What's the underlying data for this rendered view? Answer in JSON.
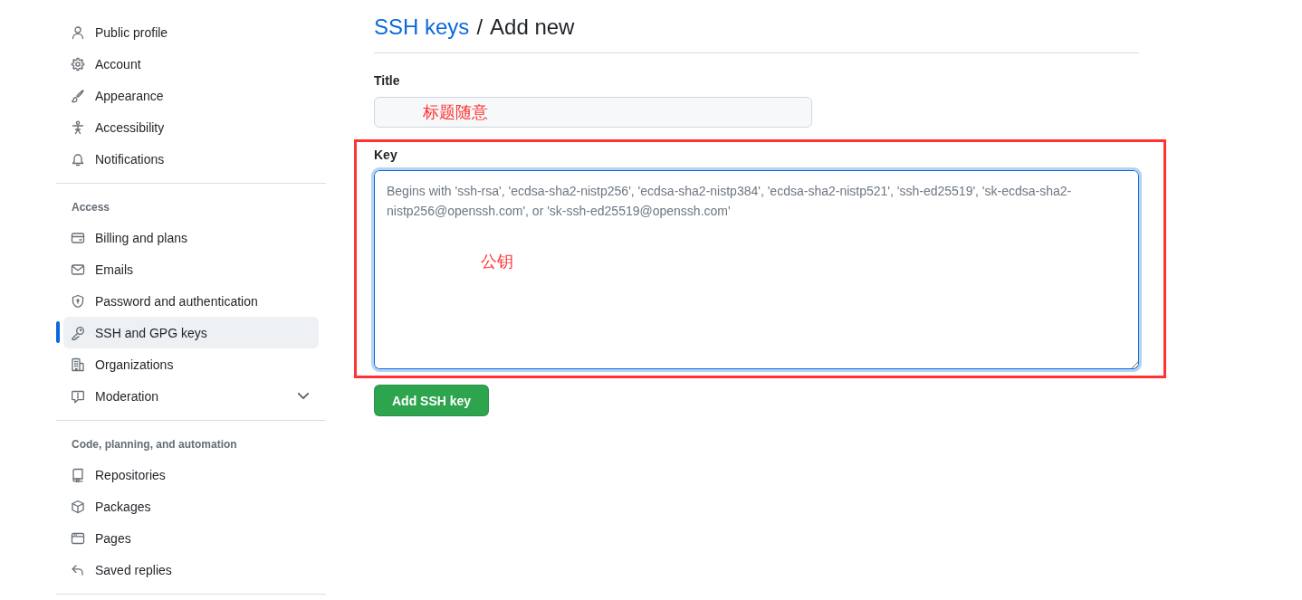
{
  "sidebar": {
    "sections": [
      {
        "items": [
          {
            "label": "Public profile",
            "selected": false,
            "kind": "link"
          },
          {
            "label": "Account",
            "selected": false,
            "kind": "link"
          },
          {
            "label": "Appearance",
            "selected": false,
            "kind": "link"
          },
          {
            "label": "Accessibility",
            "selected": false,
            "kind": "link"
          },
          {
            "label": "Notifications",
            "selected": false,
            "kind": "link"
          }
        ]
      },
      {
        "heading": "Access",
        "items": [
          {
            "label": "Billing and plans",
            "selected": false,
            "kind": "link"
          },
          {
            "label": "Emails",
            "selected": false,
            "kind": "link"
          },
          {
            "label": "Password and authentication",
            "selected": false,
            "kind": "link"
          },
          {
            "label": "SSH and GPG keys",
            "selected": true,
            "kind": "link"
          },
          {
            "label": "Organizations",
            "selected": false,
            "kind": "link"
          },
          {
            "label": "Moderation",
            "selected": false,
            "kind": "group",
            "expanded": false
          }
        ]
      },
      {
        "heading": "Code, planning, and automation",
        "items": [
          {
            "label": "Repositories",
            "selected": false,
            "kind": "link"
          },
          {
            "label": "Packages",
            "selected": false,
            "kind": "link"
          },
          {
            "label": "Pages",
            "selected": false,
            "kind": "link"
          },
          {
            "label": "Saved replies",
            "selected": false,
            "kind": "link"
          }
        ]
      }
    ]
  },
  "header": {
    "link": "SSH keys",
    "separator": "/",
    "title": "Add new"
  },
  "form": {
    "title_field": {
      "label": "Title",
      "annotation": "标题随意"
    },
    "key_field": {
      "label": "Key",
      "placeholder": "Begins with 'ssh-rsa', 'ecdsa-sha2-nistp256', 'ecdsa-sha2-nistp384', 'ecdsa-sha2-nistp521', 'ssh-ed25519', 'sk-ecdsa-sha2-nistp256@openssh.com', or 'sk-ssh-ed25519@openssh.com'",
      "focused": true,
      "highlighted": true,
      "annotation": "公钥"
    },
    "submit_button": {
      "label": "Add SSH key"
    }
  }
}
